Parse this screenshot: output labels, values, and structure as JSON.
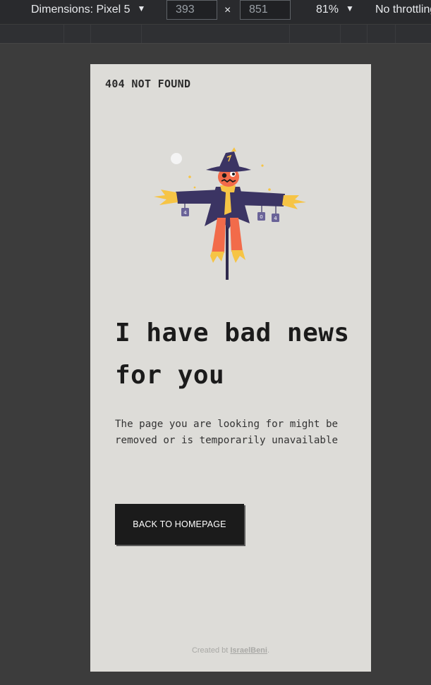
{
  "devtools": {
    "dimensions_label": "Dimensions: Pixel 5",
    "width_value": "393",
    "height_value": "851",
    "times_symbol": "×",
    "zoom": "81%",
    "throttling": "No throttling",
    "caret": "▼"
  },
  "page": {
    "brand": "404 NOT FOUND",
    "headline": "I have bad news for you",
    "message": "The page you are looking for might be removed or is temporarily unavailable",
    "button_label": "BACK TO HOMEPAGE",
    "footer": {
      "prefix": "Created bt ",
      "author": "IsraelBeni",
      "suffix": "."
    }
  },
  "colors": {
    "viewport_bg": "#dddcd8",
    "button_bg": "#1b1b1b",
    "scarecrow_hat": "#3b3463",
    "scarecrow_face": "#f26b4a",
    "scarecrow_straw": "#f6c445"
  }
}
